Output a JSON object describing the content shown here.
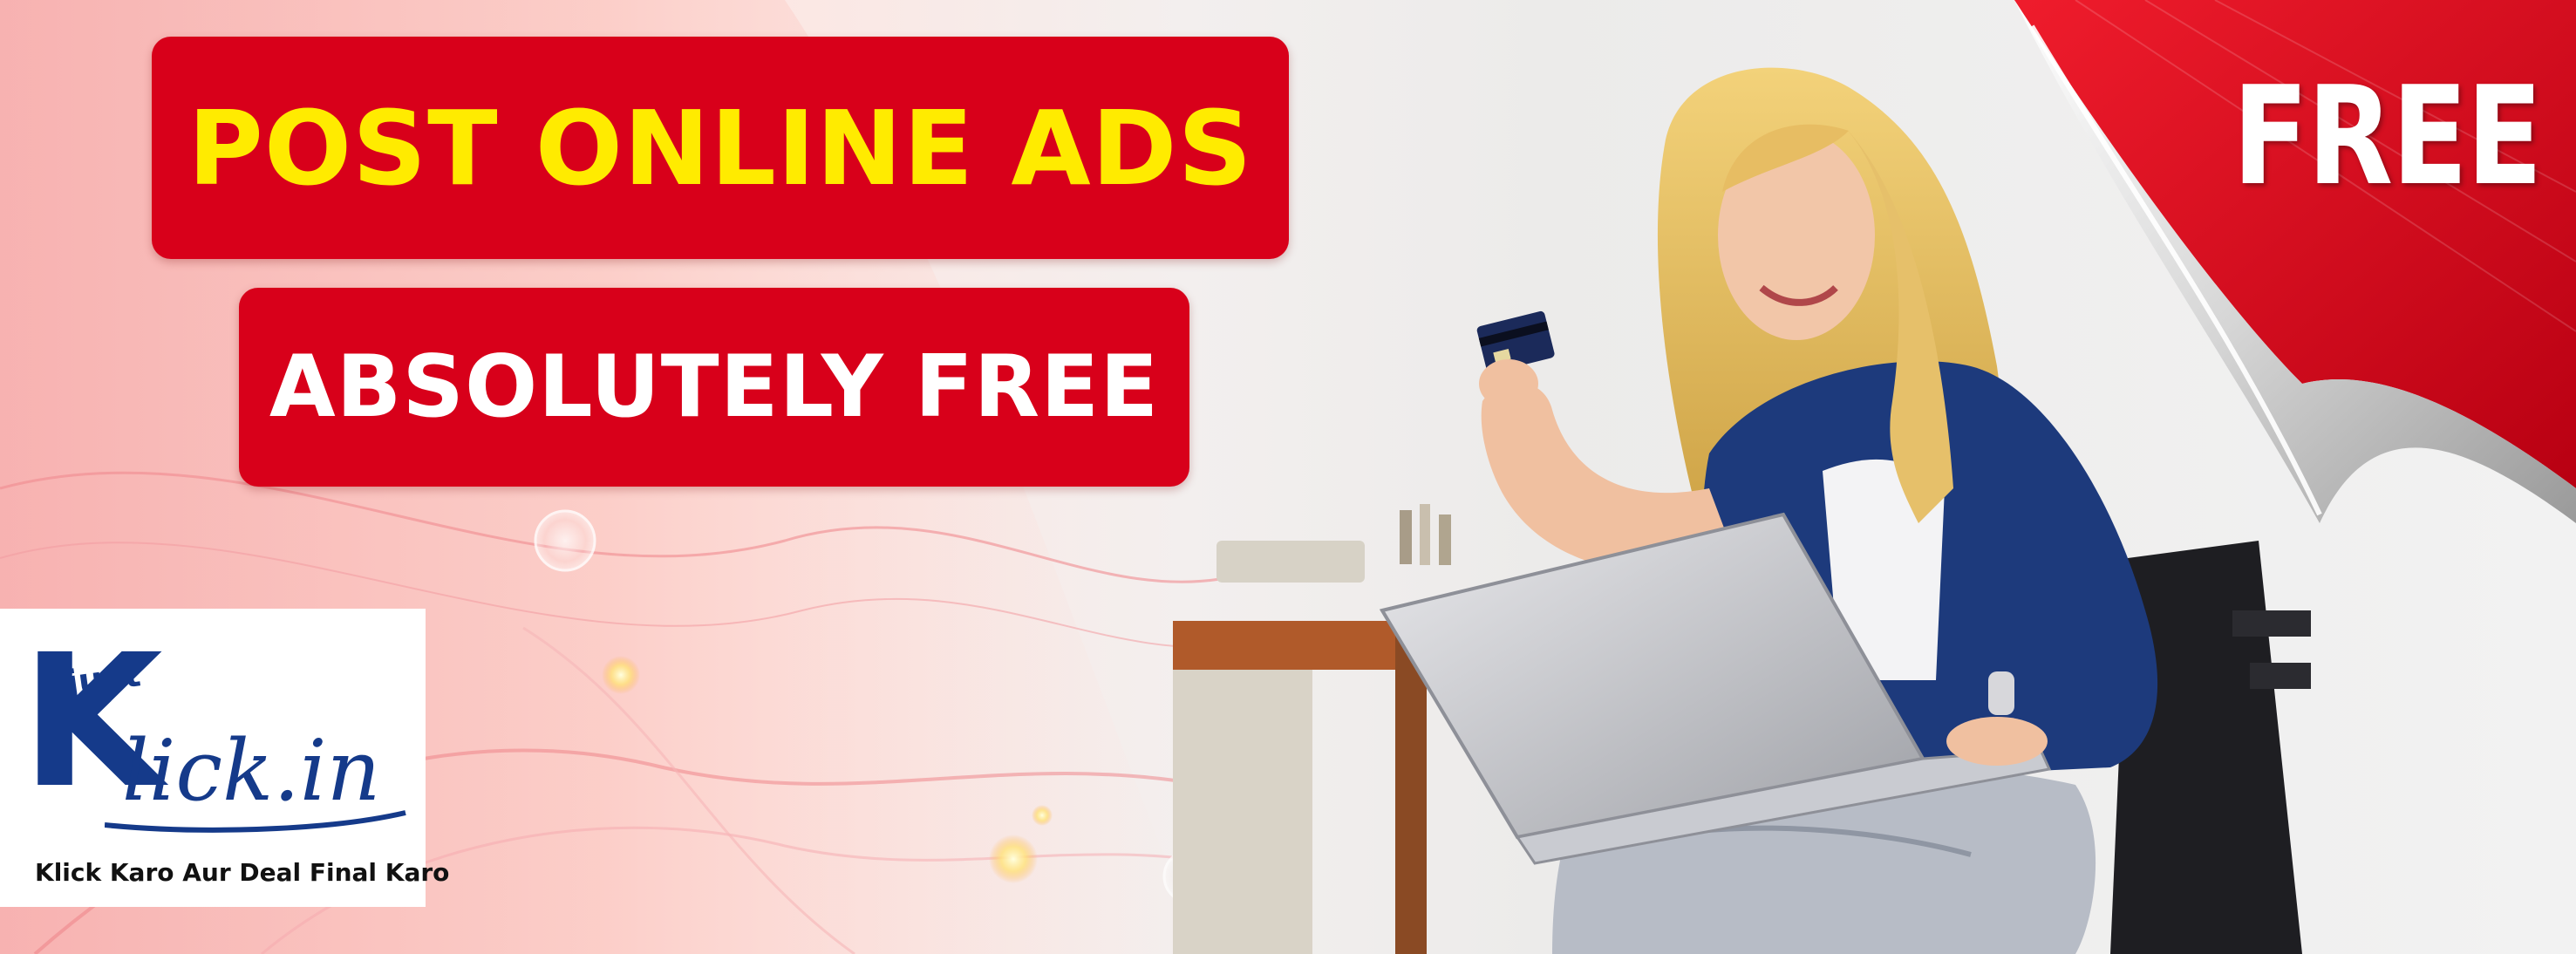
{
  "headline": {
    "primary": "POST ONLINE ADS",
    "secondary": "ABSOLUTELY FREE"
  },
  "corner_badge": "FREE",
  "logo": {
    "prefix": "just",
    "first_letter": "K",
    "rest": "lick.in",
    "tagline": "Klick Karo Aur Deal Final Karo"
  },
  "colors": {
    "pill_red": "#d8001a",
    "headline_yellow": "#ffeb00",
    "logo_blue": "#153a8a",
    "corner_red": "#d9091e"
  },
  "photo": {
    "subject": "woman-with-laptop-and-credit-card"
  }
}
